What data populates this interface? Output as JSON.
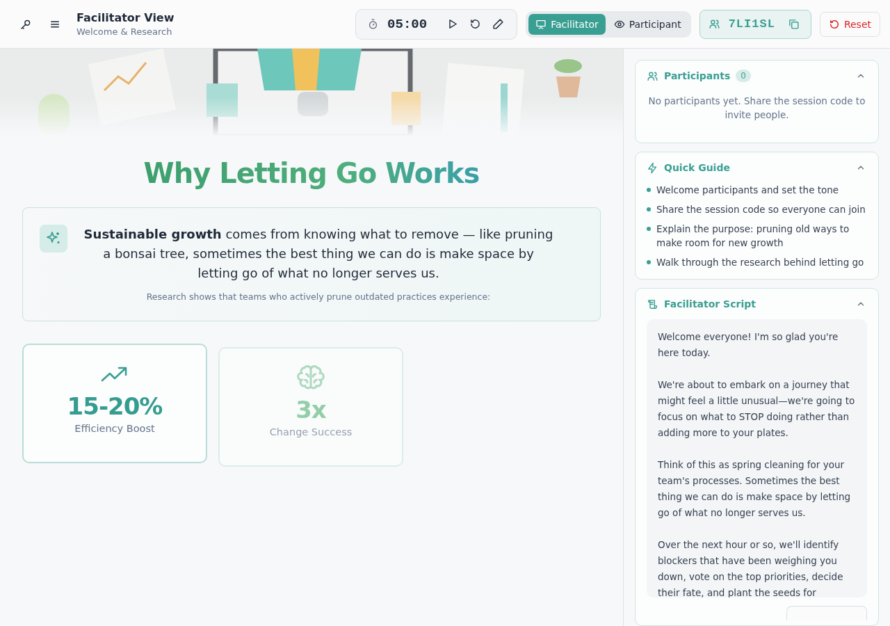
{
  "header": {
    "title": "Facilitator View",
    "subtitle": "Welcome & Research"
  },
  "timer": {
    "time": "05:00"
  },
  "modes": [
    {
      "label": "Facilitator",
      "selected": true
    },
    {
      "label": "Participant",
      "selected": false
    }
  ],
  "session": {
    "code": "7LI1SL"
  },
  "reset_button": {
    "label": "Reset"
  },
  "heading": "Why Letting Go Works",
  "intro": {
    "text": "**Sustainable growth** comes from knowing what to remove — like pruning a bonsai tree, sometimes the best thing we can do is make space by letting go of what no longer serves us.",
    "note": "Research shows that teams who actively prune outdated practices experience:"
  },
  "stats": [
    {
      "kind": "trend",
      "value": "15-20%",
      "label": "Efficiency Boost",
      "dimmed": false
    },
    {
      "kind": "brain",
      "value": "3x",
      "label": "Change Success",
      "dimmed": true
    }
  ],
  "participants": {
    "title": "Participants",
    "count": "0",
    "expanded": true,
    "empty_text": "No participants yet. Share the session code to invite people."
  },
  "guide": {
    "title": "Quick Guide",
    "expanded": true,
    "items": [
      "Welcome participants and set the tone",
      "Share the session code so everyone can join",
      "Explain the purpose: pruning old ways to make room for new growth",
      "Walk through the research behind letting go"
    ]
  },
  "script": {
    "title": "Facilitator Script",
    "expanded": true,
    "paragraphs": [
      "Welcome everyone! I'm so glad you're here today.",
      "We're about to embark on a journey that might feel a little unusual—we're going to focus on what to STOP doing rather than adding more to your plates.",
      "Think of this as spring cleaning for your team's processes. Sometimes the best thing we can do is make space by letting go of what no longer serves us.",
      "Over the next hour or so, we'll identify blockers that have been weighing you down, vote on the top priorities, decide their fate, and plant the seeds for"
    ]
  }
}
